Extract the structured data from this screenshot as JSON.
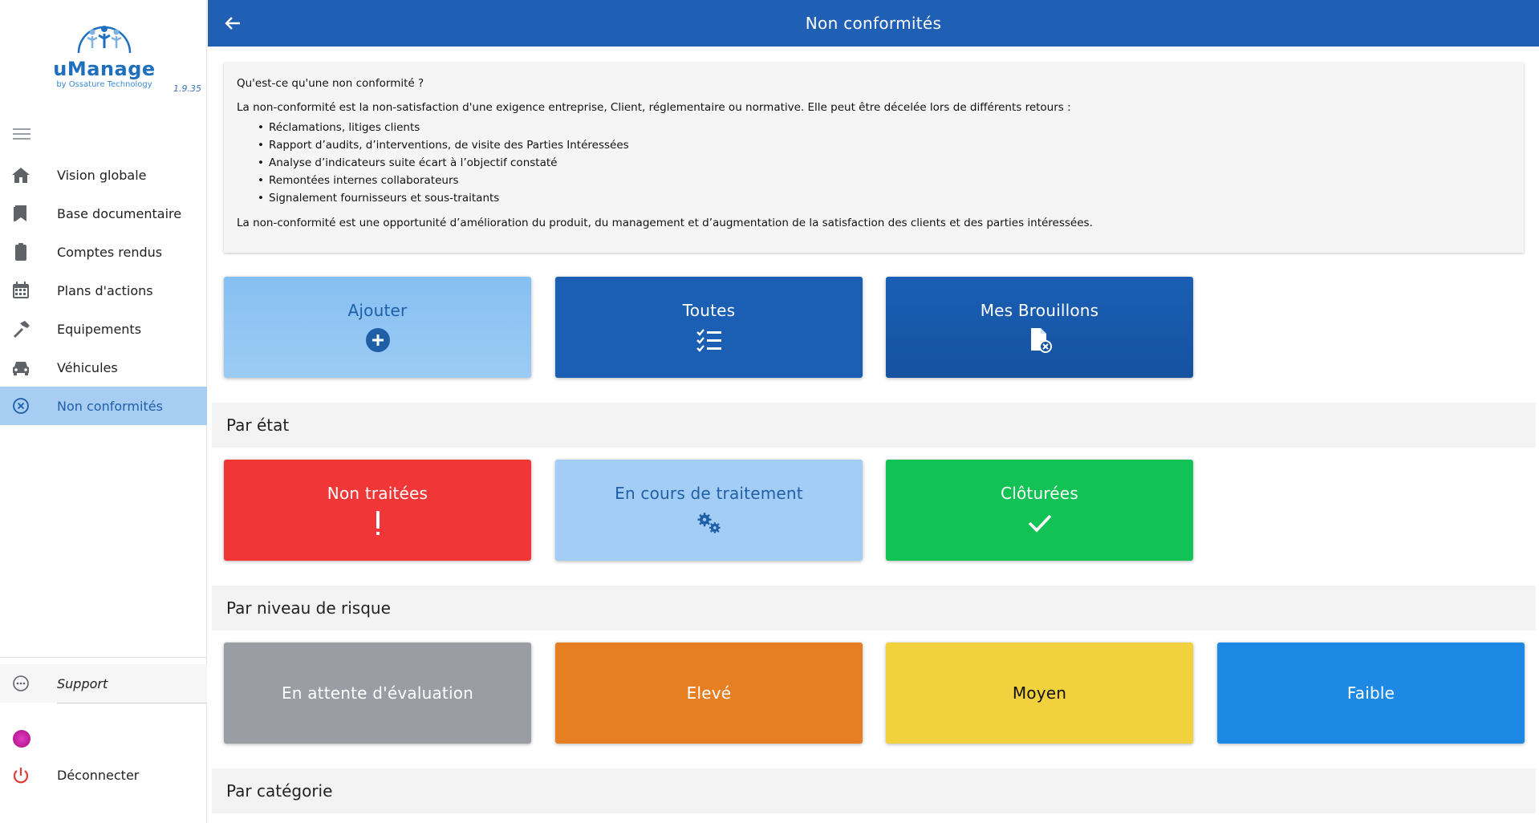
{
  "app": {
    "logo_text": "uManage",
    "logo_sub": "by Ossature Technology",
    "version": "1.9.35"
  },
  "sidebar": {
    "items": [
      {
        "label": "Vision globale",
        "icon": "home-icon"
      },
      {
        "label": "Base documentaire",
        "icon": "bookmark-icon"
      },
      {
        "label": "Comptes rendus",
        "icon": "clipboard-icon"
      },
      {
        "label": "Plans d'actions",
        "icon": "calendar-icon"
      },
      {
        "label": "Equipements",
        "icon": "hammer-icon"
      },
      {
        "label": "Véhicules",
        "icon": "car-icon"
      },
      {
        "label": "Non conformités",
        "icon": "circle-x-icon",
        "active": true
      }
    ],
    "support_label": "Support",
    "logout_label": "Déconnecter"
  },
  "header": {
    "title": "Non conformités"
  },
  "info": {
    "question": "Qu'est-ce qu'une non conformité ?",
    "intro": "La non-conformité est la non-satisfaction d'une exigence entreprise, Client, réglementaire ou normative. Elle peut être décelée lors de différents retours :",
    "bullets": [
      "Réclamations, litiges clients",
      "Rapport d’audits, d’interventions, de visite des Parties Intéressées",
      "Analyse d’indicateurs suite écart à l’objectif constaté",
      "Remontées internes collaborateurs",
      "Signalement fournisseurs et sous-traitants"
    ],
    "conclusion": "La non-conformité est une opportunité d’amélioration du produit, du management et d’augmentation de la satisfaction des clients et des parties intéressées."
  },
  "actions": {
    "add": "Ajouter",
    "all": "Toutes",
    "drafts": "Mes Brouillons"
  },
  "by_state": {
    "title": "Par état",
    "untreated": "Non traitées",
    "in_progress": "En cours de traitement",
    "closed": "Clôturées"
  },
  "by_risk": {
    "title": "Par niveau de risque",
    "pending": "En attente d'évaluation",
    "high": "Elevé",
    "medium": "Moyen",
    "low": "Faible"
  },
  "by_category": {
    "title": "Par catégorie"
  },
  "colors": {
    "primary": "#1f5fb4",
    "light_blue": "#90c4f2",
    "red": "#f03636",
    "pale_blue": "#a8cdf2",
    "green": "#12c254",
    "gray": "#9a9da4",
    "orange": "#e67f22",
    "yellow": "#f2d13e",
    "blue": "#1e88e5"
  }
}
